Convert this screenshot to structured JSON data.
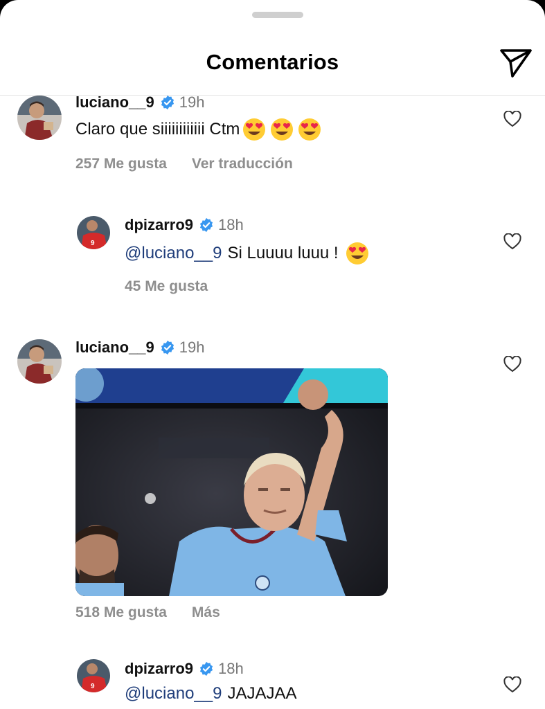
{
  "header": {
    "title": "Comentarios"
  },
  "comments": [
    {
      "username": "luciano__9",
      "time": "19h",
      "text": "Claro que siiiiiiiiiiii Ctm",
      "likes": "257 Me gusta",
      "action": "Ver traducción"
    },
    {
      "username": "dpizarro9",
      "time": "18h",
      "mention": "@luciano__9",
      "text": "Si Luuuu luuu !",
      "likes": "45 Me gusta"
    },
    {
      "username": "luciano__9",
      "time": "19h",
      "likes": "518 Me gusta",
      "action": "Más"
    },
    {
      "username": "dpizarro9",
      "time": "18h",
      "mention": "@luciano__9",
      "text": "JAJAJAA"
    }
  ],
  "icons": {
    "send": "send-icon",
    "like": "heart-icon",
    "verified": "verified-badge-icon",
    "emoji": "heart-eyes-emoji"
  },
  "colors": {
    "verified_blue": "#3897f0",
    "mention": "#1f3d7a",
    "muted": "#8e8e8e"
  }
}
